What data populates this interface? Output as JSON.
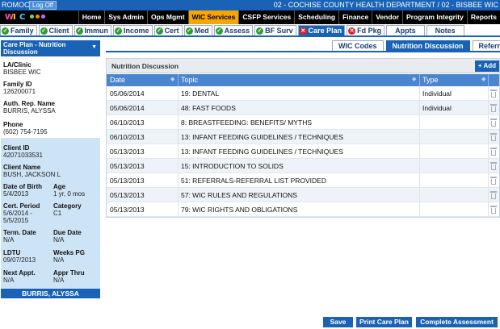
{
  "topbar": {
    "app_name": "ROMOC",
    "logoff_label": "Log Off",
    "department": "02 - COCHISE COUNTY HEALTH DEPARTMENT / 02 - BISBEE WIC"
  },
  "logo": {
    "letters": [
      "W",
      "I",
      "C"
    ]
  },
  "menu": {
    "items": [
      {
        "label": "Home"
      },
      {
        "label": "Sys Admin"
      },
      {
        "label": "Ops Mgmt"
      },
      {
        "label": "WIC Services"
      },
      {
        "label": "CSFP Services"
      },
      {
        "label": "Scheduling"
      },
      {
        "label": "Finance"
      },
      {
        "label": "Vendor"
      },
      {
        "label": "Program Integrity"
      },
      {
        "label": "Reports"
      }
    ],
    "active": "WIC Services"
  },
  "module_tabs": [
    {
      "label": "Family",
      "status": "ok"
    },
    {
      "label": "Client",
      "status": "ok"
    },
    {
      "label": "Immun",
      "status": "ok"
    },
    {
      "label": "Income",
      "status": "ok"
    },
    {
      "label": "Cert",
      "status": "ok"
    },
    {
      "label": "Med",
      "status": "ok"
    },
    {
      "label": "Assess",
      "status": "ok"
    },
    {
      "label": "BF Surv",
      "status": "ok"
    },
    {
      "label": "Care Plan",
      "status": "err"
    },
    {
      "label": "Fd Pkg",
      "status": "err"
    },
    {
      "label": "Appts",
      "status": "none"
    },
    {
      "label": "Notes",
      "status": "none"
    }
  ],
  "left_panel": {
    "header": "Care Plan - Nutrition Discussion",
    "la_clinic_label": "LA/Clinic",
    "la_clinic": "BISBEE WIC",
    "family_id_label": "Family ID",
    "family_id": "126200071",
    "auth_rep_label": "Auth. Rep. Name",
    "auth_rep": "BURRIS, ALYSSA",
    "phone_label": "Phone",
    "phone": "(602) 754-7195",
    "client_id_label": "Client ID",
    "client_id": "42071033531",
    "client_name_label": "Client Name",
    "client_name": "BUSH, JACKSON L",
    "dob_label": "Date of Birth",
    "dob": "5/4/2013",
    "age_label": "Age",
    "age": "1 yr, 0 mos",
    "cert_period_label": "Cert. Period",
    "cert_period_start": "5/6/2014 -",
    "cert_period_end": "5/5/2015",
    "category_label": "Category",
    "category": "C1",
    "term_date_label": "Term. Date",
    "term_date": "N/A",
    "due_date_label": "Due Date",
    "due_date": "N/A",
    "ldtu_label": "LDTU",
    "ldtu": "09/07/2013",
    "weeks_pg_label": "Weeks PG",
    "weeks_pg": "N/A",
    "next_appt_label": "Next Appt.",
    "next_appt": "N/A",
    "appr_thru_label": "Appr Thru",
    "appr_thru": "N/A",
    "footer": "BURRIS, ALYSSA"
  },
  "sub_tabs": [
    {
      "label": "WIC Codes"
    },
    {
      "label": "Nutrition Discussion"
    },
    {
      "label": "Referrals"
    }
  ],
  "sub_tab_active": "Nutrition Discussion",
  "panel": {
    "title": "Nutrition Discussion",
    "add_label": "Add",
    "columns": [
      "Date",
      "Topic",
      "Type"
    ],
    "rows": [
      {
        "date": "05/06/2014",
        "topic": "19: DENTAL",
        "type": "Individual"
      },
      {
        "date": "05/06/2014",
        "topic": "48: FAST FOODS",
        "type": "Individual"
      },
      {
        "date": "06/10/2013",
        "topic": "8: BREASTFEEDING: BENEFITS/ MYTHS",
        "type": ""
      },
      {
        "date": "06/10/2013",
        "topic": "13: INFANT FEEDING GUIDELINES / TECHNIQUES",
        "type": ""
      },
      {
        "date": "05/13/2013",
        "topic": "13: INFANT FEEDING GUIDELINES / TECHNIQUES",
        "type": ""
      },
      {
        "date": "05/13/2013",
        "topic": "15: INTRODUCTION TO SOLIDS",
        "type": ""
      },
      {
        "date": "05/13/2013",
        "topic": "51: REFERRALS-REFERRAL LIST PROVIDED",
        "type": ""
      },
      {
        "date": "05/13/2013",
        "topic": "57: WIC RULES AND REGULATIONS",
        "type": ""
      },
      {
        "date": "05/13/2013",
        "topic": "79: WIC RIGHTS AND OBLIGATIONS",
        "type": ""
      }
    ]
  },
  "buttons": {
    "save": "Save",
    "print": "Print Care Plan",
    "complete": "Complete Assessment"
  },
  "colors": {
    "primary_blue": "#1a62b6",
    "active_menu": "#f7a600",
    "ok_icon": "#2e9e2e",
    "error_icon": "#e02020"
  }
}
